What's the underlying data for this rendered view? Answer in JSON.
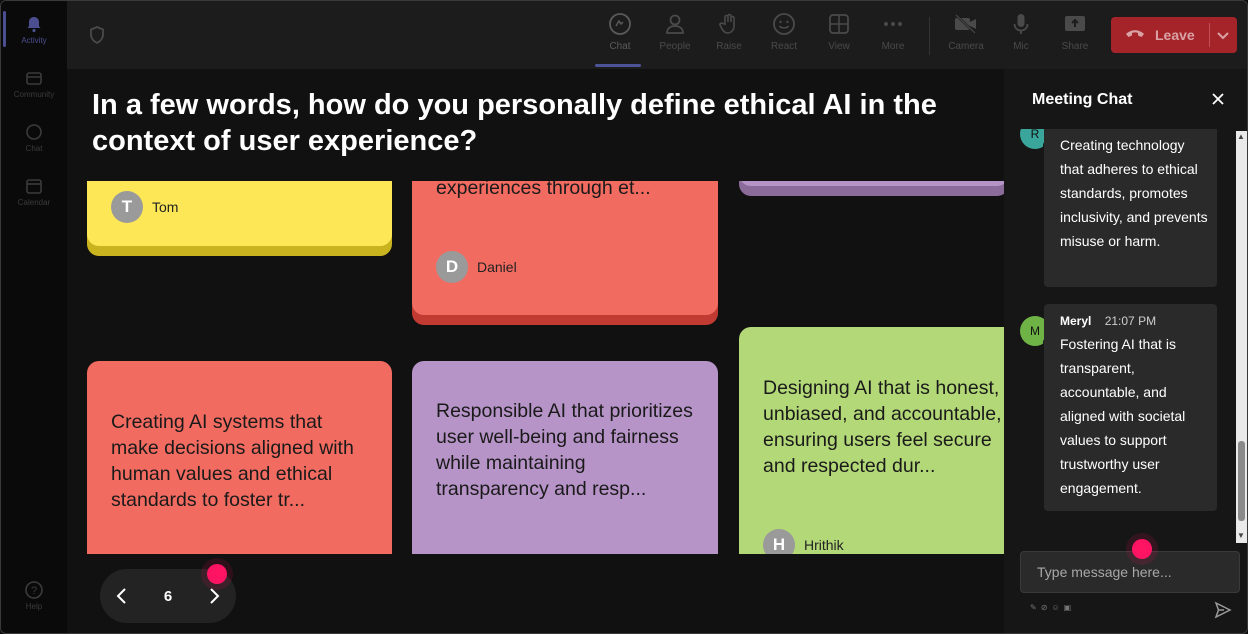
{
  "rail": {
    "items": [
      {
        "label": "Activity",
        "icon": "bell-icon",
        "active": true
      },
      {
        "label": "Community",
        "icon": "community-icon",
        "active": false
      },
      {
        "label": "Chat",
        "icon": "chat-icon",
        "active": false
      },
      {
        "label": "Calendar",
        "icon": "calendar-icon",
        "active": false
      }
    ],
    "help": "Help"
  },
  "toolbar": {
    "buttons": [
      {
        "label": "Chat",
        "icon": "chat-icon"
      },
      {
        "label": "People",
        "icon": "people-icon"
      },
      {
        "label": "Raise",
        "icon": "raise-hand-icon"
      },
      {
        "label": "React",
        "icon": "react-icon"
      },
      {
        "label": "View",
        "icon": "view-grid-icon"
      },
      {
        "label": "More",
        "icon": "more-icon"
      },
      {
        "label": "Camera",
        "icon": "camera-off-icon"
      },
      {
        "label": "Mic",
        "icon": "mic-icon"
      },
      {
        "label": "Share",
        "icon": "share-icon"
      }
    ],
    "leave_label": "Leave",
    "leave_color": "#a5242a"
  },
  "question": "In a few words, how do you personally define ethical AI in the context of user experience?",
  "notes": [
    {
      "color": "#fde756",
      "shadow": "#c9b41f",
      "text": "",
      "author": "Tom",
      "initial": "T"
    },
    {
      "color": "#f26b60",
      "shadow": "#c23b33",
      "text": "experiences through et...",
      "author": "Daniel",
      "initial": "D"
    },
    {
      "color": "#b794c8",
      "shadow": "#8a6b9a",
      "text": "",
      "author": "",
      "initial": ""
    },
    {
      "color": "#f26b60",
      "shadow": "#c23b33",
      "text": "Creating AI systems that make decisions aligned with human values and ethical standards to foster tr...",
      "author": "",
      "initial": ""
    },
    {
      "color": "#b794c8",
      "shadow": "#8a6b9a",
      "text": "Responsible AI that prioritizes user well-being and fairness while maintaining transparency and resp...",
      "author": "",
      "initial": ""
    },
    {
      "color": "#b3d877",
      "shadow": "#8aa653",
      "text": "Designing AI that is honest, unbiased, and accountable, ensuring users feel secure and respected dur...",
      "author": "Hrithik",
      "initial": "H"
    }
  ],
  "pager": {
    "page": "6"
  },
  "chat": {
    "title": "Meeting Chat",
    "messages": [
      {
        "initial": "R",
        "name": "",
        "time": "",
        "text": "Creating technology that adheres to ethical standards, promotes inclusivity, and prevents misuse or harm.",
        "avatar_color": "#3aa59a"
      },
      {
        "initial": "M",
        "name": "Meryl",
        "time": "21:07 PM",
        "text": "Fostering AI that is transparent, accountable, and aligned with societal values to support trustworthy user engagement.",
        "avatar_color": "#6fb346"
      }
    ],
    "placeholder": "Type message here..."
  },
  "accent": "#4c5396",
  "cursor_color": "#ff1464"
}
